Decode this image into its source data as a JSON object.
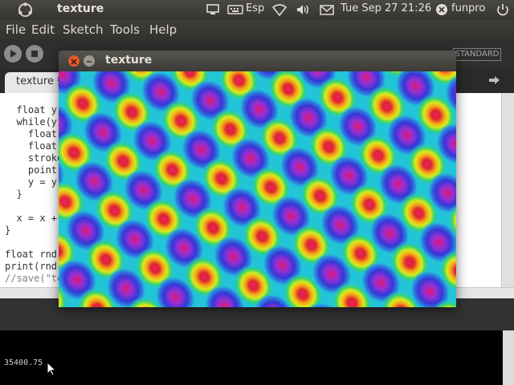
{
  "top_panel": {
    "app_title": "texture",
    "keyboard_layout": "Esp",
    "clock": "Tue Sep 27 21:26",
    "user": "funpro"
  },
  "menu": {
    "items": [
      "File",
      "Edit",
      "Sketch",
      "Tools",
      "Help"
    ]
  },
  "toolbar": {
    "mode_label": "STANDARD"
  },
  "tab": {
    "label": "texture §"
  },
  "editor": {
    "lines": [
      "  float y",
      "  while(y",
      "    float",
      "    float",
      "    stroke",
      "    point(",
      "    y = y",
      "  }",
      "",
      "  x = x +",
      "}",
      "",
      "float rnd",
      "print(rnd)",
      "//save(\"te"
    ]
  },
  "sketch_window": {
    "title": "texture"
  },
  "console": {
    "output": "35400.75"
  },
  "icons": {
    "ubuntu_logo": "ubuntu-logo-icon",
    "display": "display-icon",
    "keyboard": "keyboard-icon",
    "network": "wifi-icon",
    "volume": "volume-icon",
    "mail": "mail-icon",
    "user": "user-close-icon",
    "power": "power-icon"
  }
}
